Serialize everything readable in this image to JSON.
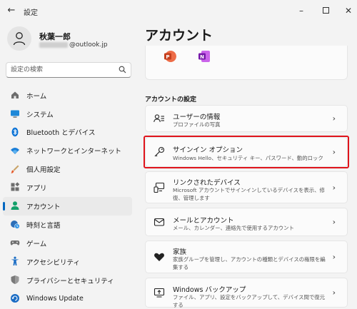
{
  "titlebar": {
    "back_icon": "arrow-left-icon",
    "title": "設定",
    "controls": [
      "minimize-icon",
      "maximize-icon",
      "close-icon"
    ]
  },
  "profile": {
    "name": "秋葉一郎",
    "email_suffix": "@outlook.jp",
    "avatar_icon": "person-icon"
  },
  "search": {
    "placeholder": "設定の検索",
    "icon": "search-icon"
  },
  "sidebar": {
    "active_index": 6,
    "items": [
      {
        "label": "ホーム",
        "icon": "home-icon"
      },
      {
        "label": "システム",
        "icon": "monitor-icon"
      },
      {
        "label": "Bluetooth とデバイス",
        "icon": "bluetooth-icon"
      },
      {
        "label": "ネットワークとインターネット",
        "icon": "wifi-icon"
      },
      {
        "label": "個人用設定",
        "icon": "brush-icon"
      },
      {
        "label": "アプリ",
        "icon": "apps-icon"
      },
      {
        "label": "アカウント",
        "icon": "account-icon"
      },
      {
        "label": "時刻と言語",
        "icon": "clock-globe-icon"
      },
      {
        "label": "ゲーム",
        "icon": "gamepad-icon"
      },
      {
        "label": "アクセシビリティ",
        "icon": "accessibility-icon"
      },
      {
        "label": "プライバシーとセキュリティ",
        "icon": "shield-icon"
      },
      {
        "label": "Windows Update",
        "icon": "windows-update-icon"
      }
    ]
  },
  "main": {
    "title": "アカウント",
    "apps": [
      "powerpoint-icon",
      "onenote-icon"
    ],
    "section_title": "アカウントの設定",
    "cards": [
      {
        "title": "ユーザーの情報",
        "subtitle": "プロファイルの写真",
        "icon": "person-card-icon"
      },
      {
        "title": "サインイン オプション",
        "subtitle": "Windows Hello、セキュリティ キー、パスワード、動的ロック",
        "icon": "key-icon"
      },
      {
        "title": "リンクされたデバイス",
        "subtitle": "Microsoft アカウントでサインインしているデバイスを表示、修復、管理します",
        "icon": "devices-icon"
      },
      {
        "title": "メールとアカウント",
        "subtitle": "メール、カレンダー、連絡先で使用するアカウント",
        "icon": "mail-icon"
      },
      {
        "title": "家族",
        "subtitle": "家族グループを管理し、アカウントの種類とデバイスの権限を編集する",
        "icon": "heart-icon"
      },
      {
        "title": "Windows バックアップ",
        "subtitle": "ファイル、アプリ、設定をバックアップして、デバイス間で復元する",
        "icon": "backup-icon"
      }
    ],
    "chevron": "›",
    "highlight_color": "#e0141c"
  }
}
